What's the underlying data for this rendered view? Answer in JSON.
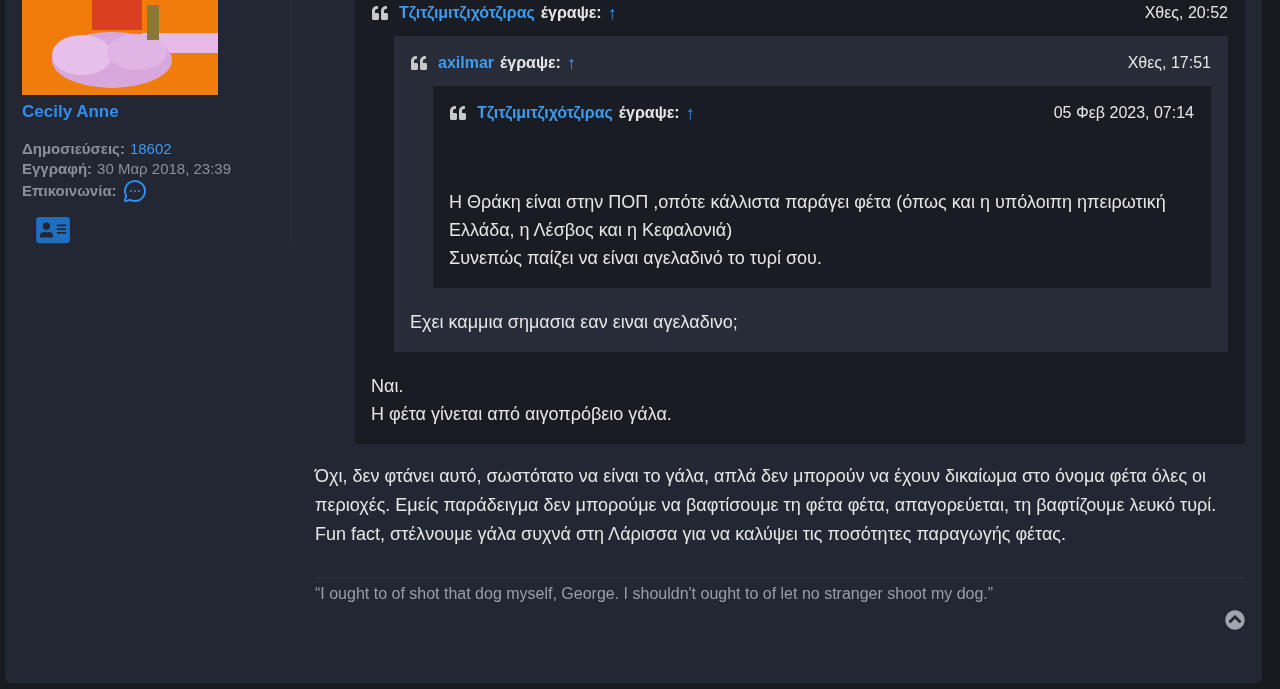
{
  "user": {
    "name": "Cecily Anne",
    "stats": [
      {
        "label": "Δημοσιεύσεις:",
        "value": "18602",
        "kind": "link"
      },
      {
        "label": "Εγγραφή:",
        "value": "30 Μαρ 2018, 23:39",
        "kind": "text"
      },
      {
        "label": "Επικοινωνία:",
        "kind": "contact"
      }
    ]
  },
  "post": {
    "quote": {
      "author": "Τζιτζιμιτζιχότζιρας",
      "wrote": "έγραψε:",
      "arrow": "↑",
      "time": "Χθες, 20:52",
      "quote": {
        "author": "axilmar",
        "wrote": "έγραψε:",
        "arrow": "↑",
        "time": "Χθες, 17:51",
        "quote": {
          "author": "Τζιτζιμιτζιχότζιρας",
          "wrote": "έγραψε:",
          "arrow": "↑",
          "time": "05 Φεβ 2023, 07:14",
          "lines": [
            "Η Θράκη είναι στην ΠΟΠ ,οπότε κάλλιστα παράγει φέτα (όπως και η υπόλοιπη ηπειρωτική Ελλάδα, η Λέσβος και η Κεφαλονιά)",
            "Συνεπώς παίζει να είναι αγελαδινό το τυρί σου."
          ]
        },
        "lines": [
          "Εχει καμμια σημασια εαν ειναι αγελαδινο;"
        ]
      },
      "lines": [
        "Ναι.",
        "Η φέτα γίνεται από αιγοπρόβειο γάλα."
      ]
    },
    "lines": [
      "Όχι, δεν φτάνει αυτό, σωστότατο να είναι το γάλα, απλά δεν μπορούν να έχουν δικαίωμα στο όνομα φέτα όλες οι περιοχές. Εμείς παράδειγμα δεν μπορούμε να βαφτίσουμε τη φέτα φέτα, απαγορεύεται, τη βαφτίζουμε λευκό τυρί. Fun fact, στέλνουμε γάλα συχνά στη Λάρισσα για να καλύψει τις ποσότητες παραγωγής φέτας."
    ],
    "signature": "“I ought to of shot that dog myself, George. I shouldn't ought to of let no stranger shoot my dog.”"
  }
}
